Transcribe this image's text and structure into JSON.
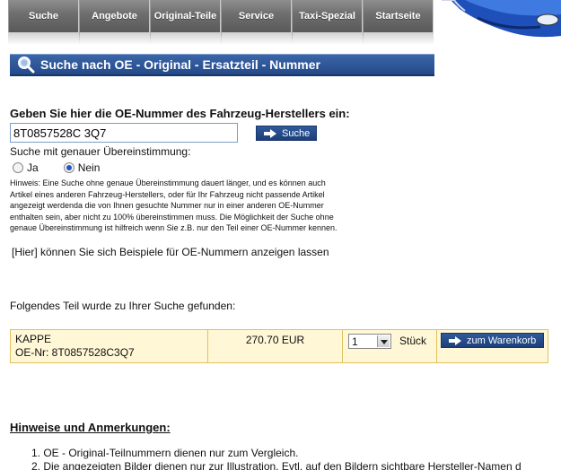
{
  "nav": {
    "items": [
      {
        "label": "Suche"
      },
      {
        "label": "Angebote"
      },
      {
        "label": "Original-Teile"
      },
      {
        "label": "Service"
      },
      {
        "label": "Taxi-Spezial"
      },
      {
        "label": "Startseite"
      }
    ]
  },
  "header": {
    "title": "Suche nach OE - Original - Ersatzteil - Nummer",
    "icon": "magnifier-icon"
  },
  "search": {
    "label": "Geben Sie hier die OE-Nummer des Fahrzeug-Herstellers ein:",
    "value": "8T0857528C 3Q7",
    "button_label": "Suche",
    "match_label": "Suche mit genauer Übereinstimmung:",
    "option_yes": "Ja",
    "option_no": "Nein",
    "selected": "Nein"
  },
  "hint": {
    "lines": [
      "Hinweis: Eine Suche ohne genaue Übereinstimmung dauert länger, und es können auch",
      "Artikel eines anderen Fahrzeug-Herstellers, oder für Ihr Fahrzeug nicht passende Artikel",
      "angezeigt werdenda die von Ihnen gesuchte Nummer nur in einer anderen OE-Nummer",
      "enthalten sein, aber nicht zu 100% übereinstimmen muss. Die Möglichkeit der Suche ohne",
      "genaue Übereinstimmung ist hilfreich wenn Sie z.B. nur den Teil einer OE-Nummer kennen."
    ]
  },
  "examples": {
    "text": "[Hier] können Sie sich Beispiele für OE-Nummern anzeigen lassen"
  },
  "result": {
    "found_text": "Folgendes Teil wurde zu Ihrer Suche gefunden:",
    "name": "KAPPE",
    "oe_number": "OE-Nr: 8T0857528C3Q7",
    "price": "270.70 EUR",
    "quantity": "1",
    "unit": "Stück",
    "cart_button": "zum Warenkorb"
  },
  "notes": {
    "title": "Hinweise und Anmerkungen:",
    "items": [
      "1. OE - Original-Teilnummern dienen nur zum Vergleich.",
      "2. Die angezeigten Bilder dienen nur zur Illustration. Evtl. auf den Bildern sichtbare Hersteller-Namen d"
    ]
  },
  "colors": {
    "nav_bg": "#6d6d6d",
    "header_bg": "#2c5494",
    "result_bg": "#fff7d6",
    "result_border": "#e0c15c",
    "button_bg": "#24498a"
  }
}
